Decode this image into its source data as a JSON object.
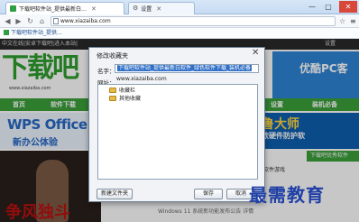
{
  "browser": {
    "tabs": [
      {
        "label": "下载吧软件站_提供最新白…"
      },
      {
        "label": "设置"
      }
    ],
    "window_controls": {
      "restore": "▢",
      "minimize": "—",
      "close": "✕"
    },
    "address": "www.xiazaiba.com",
    "bookmark_bar_item": "下载吧软件站_提供…",
    "icons": {
      "back": "◀",
      "forward": "▶",
      "refresh": "↻",
      "home": "⌂",
      "star": "☆",
      "menu": "≡"
    }
  },
  "page": {
    "topline_left": "中文在线|安卓下载吧|进入本站|",
    "topline_right": "设置",
    "logo_text": "下载吧",
    "logo_sub": "www.xiazaiba.com",
    "ad_right": "优酷PC客",
    "nav_items": [
      "首页",
      "软件下载",
      "设置",
      "装机必备"
    ],
    "wps_line1": "WPS Office",
    "wps_line2": "新办公体验",
    "banner_line1": "鲁大师",
    "banner_line2": "球首款硬件防护软",
    "game_title": "争风独斗",
    "tab_hint": "软件游戏",
    "rightpanel_header": "下载吧优秀软件",
    "news_line": "Windows 11 系统新功能发布公告 详情"
  },
  "dialog": {
    "title": "修改收藏夹",
    "close_icon": "✕",
    "name_label": "名字：",
    "name_value": "下载吧软件站_提供最新白软件_绿色软件下载_装机必备",
    "url_label": "网址：",
    "url_value": "www.xiazaiba.com",
    "folders": [
      "收藏栏",
      "其他收藏"
    ],
    "buttons": {
      "new_folder": "新建文件夹",
      "save": "保存",
      "cancel": "取消"
    }
  },
  "watermark": "最需教育"
}
